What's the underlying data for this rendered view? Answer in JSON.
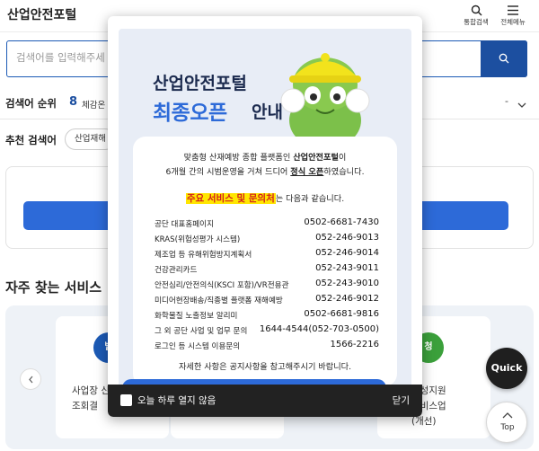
{
  "header": {
    "logo": "산업안전포털",
    "search_label": "통합검색",
    "menu_label": "전체메뉴"
  },
  "search": {
    "placeholder": "검색어를 입력해주세"
  },
  "ranking": {
    "title": "검색어 순위",
    "number": "8",
    "word": "체감온",
    "dash": "-"
  },
  "recommend": {
    "title": "추천 검색어",
    "chip": "산업재해"
  },
  "services": {
    "title": "자주 찾는 서비스",
    "card1_badge": "발",
    "card1_lines": [
      "사업장 신",
      "조회결"
    ],
    "card3_badge": "청",
    "card3_lines": [
      "조성지원",
      "서비스업",
      "(개선)"
    ]
  },
  "popup": {
    "title1": "산업안전포털",
    "title2": "최종오픈",
    "title2b": "안내",
    "intro_line1_pre": "맞춤형 산재예방 종합 플랫폼인 ",
    "intro_line1_bold": "산업안전포털",
    "intro_line1_post": "이",
    "intro_line2_pre": "6개월 간의 시범운영을 거쳐 드디어 ",
    "intro_line2_under": "정식 오픈",
    "intro_line2_post": "하였습니다.",
    "highlight": "주요 서비스 및 문의처",
    "highlight_post": "는 다음과 같습니다.",
    "contacts": [
      {
        "name": "공단 대표홈페이지",
        "phone": "0502-6681-7430"
      },
      {
        "name": "KRAS(위험성평가 시스템)",
        "phone": "052-246-9013"
      },
      {
        "name": "제조업 등 유해위험방지계획서",
        "phone": "052-246-9014"
      },
      {
        "name": "건강관리카드",
        "phone": "052-243-9011"
      },
      {
        "name": "안전심리/안전의식(KSCI 포함)/VR전용관",
        "phone": "052-243-9010"
      },
      {
        "name": "미디어현장배송/직종별 플랫폼 재해예방",
        "phone": "052-246-9012"
      },
      {
        "name": "화학물질 노출정보 알리미",
        "phone": "0502-6681-9816"
      },
      {
        "name": "그 외 공단 사업 및 업무 문의",
        "phone": "1644-4544(052-703-0500)"
      },
      {
        "name": "로그인 등 시스템 이용문의",
        "phone": "1566-2216"
      }
    ],
    "footer": "자세한 사항은 공지사항을 참고해주시기 바랍니다.",
    "dont_show_today": "오늘 하루 열지 않음",
    "close": "닫기"
  },
  "floating": {
    "quick": "Quick",
    "top": "Top"
  },
  "colors": {
    "brand_blue": "#2d6ad8",
    "dark_navy": "#1b2a4e",
    "highlight_yellow": "#ffe600",
    "highlight_red": "#d21e1e"
  }
}
